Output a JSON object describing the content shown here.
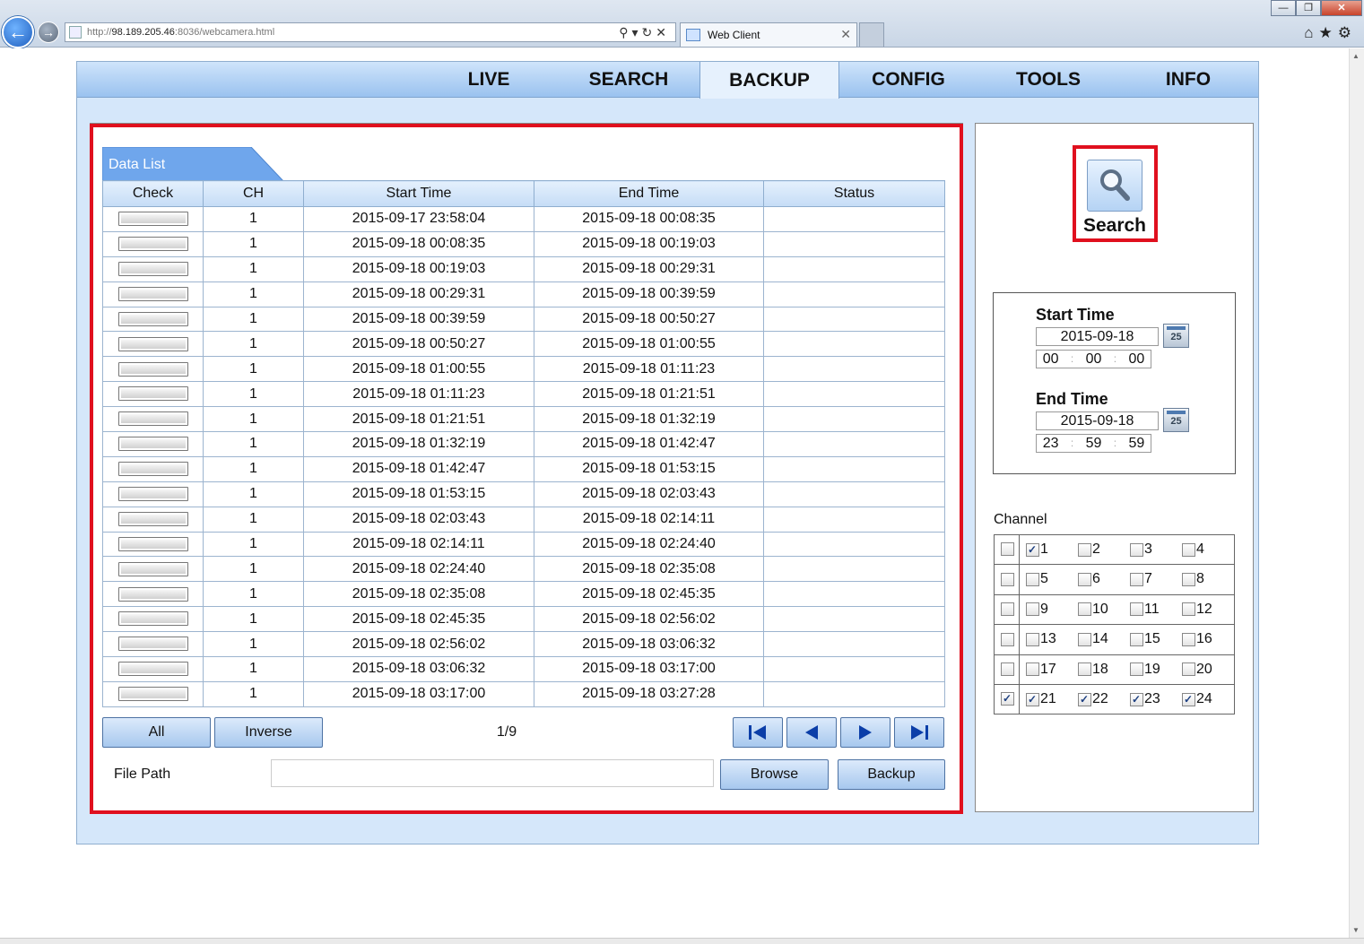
{
  "browser": {
    "url_prefix": "http://",
    "url_host": "98.189.205.46",
    "url_rest": ":8036/webcamera.html",
    "tab_title": "Web Client"
  },
  "menu": [
    "LIVE",
    "SEARCH",
    "BACKUP",
    "CONFIG",
    "TOOLS",
    "INFO"
  ],
  "active_menu": "BACKUP",
  "data_list": {
    "title": "Data List",
    "columns": [
      "Check",
      "CH",
      "Start Time",
      "End Time",
      "Status"
    ],
    "rows": [
      {
        "ch": "1",
        "start": "2015-09-17 23:58:04",
        "end": "2015-09-18 00:08:35",
        "status": ""
      },
      {
        "ch": "1",
        "start": "2015-09-18 00:08:35",
        "end": "2015-09-18 00:19:03",
        "status": ""
      },
      {
        "ch": "1",
        "start": "2015-09-18 00:19:03",
        "end": "2015-09-18 00:29:31",
        "status": ""
      },
      {
        "ch": "1",
        "start": "2015-09-18 00:29:31",
        "end": "2015-09-18 00:39:59",
        "status": ""
      },
      {
        "ch": "1",
        "start": "2015-09-18 00:39:59",
        "end": "2015-09-18 00:50:27",
        "status": ""
      },
      {
        "ch": "1",
        "start": "2015-09-18 00:50:27",
        "end": "2015-09-18 01:00:55",
        "status": ""
      },
      {
        "ch": "1",
        "start": "2015-09-18 01:00:55",
        "end": "2015-09-18 01:11:23",
        "status": ""
      },
      {
        "ch": "1",
        "start": "2015-09-18 01:11:23",
        "end": "2015-09-18 01:21:51",
        "status": ""
      },
      {
        "ch": "1",
        "start": "2015-09-18 01:21:51",
        "end": "2015-09-18 01:32:19",
        "status": ""
      },
      {
        "ch": "1",
        "start": "2015-09-18 01:32:19",
        "end": "2015-09-18 01:42:47",
        "status": ""
      },
      {
        "ch": "1",
        "start": "2015-09-18 01:42:47",
        "end": "2015-09-18 01:53:15",
        "status": ""
      },
      {
        "ch": "1",
        "start": "2015-09-18 01:53:15",
        "end": "2015-09-18 02:03:43",
        "status": ""
      },
      {
        "ch": "1",
        "start": "2015-09-18 02:03:43",
        "end": "2015-09-18 02:14:11",
        "status": ""
      },
      {
        "ch": "1",
        "start": "2015-09-18 02:14:11",
        "end": "2015-09-18 02:24:40",
        "status": ""
      },
      {
        "ch": "1",
        "start": "2015-09-18 02:24:40",
        "end": "2015-09-18 02:35:08",
        "status": ""
      },
      {
        "ch": "1",
        "start": "2015-09-18 02:35:08",
        "end": "2015-09-18 02:45:35",
        "status": ""
      },
      {
        "ch": "1",
        "start": "2015-09-18 02:45:35",
        "end": "2015-09-18 02:56:02",
        "status": ""
      },
      {
        "ch": "1",
        "start": "2015-09-18 02:56:02",
        "end": "2015-09-18 03:06:32",
        "status": ""
      },
      {
        "ch": "1",
        "start": "2015-09-18 03:06:32",
        "end": "2015-09-18 03:17:00",
        "status": ""
      },
      {
        "ch": "1",
        "start": "2015-09-18 03:17:00",
        "end": "2015-09-18 03:27:28",
        "status": ""
      }
    ]
  },
  "controls": {
    "all_label": "All",
    "inverse_label": "Inverse",
    "page_indicator": "1/9",
    "file_path_label": "File Path",
    "file_path_value": "",
    "browse_label": "Browse",
    "backup_label": "Backup"
  },
  "search_panel": {
    "search_label": "Search",
    "start_time_label": "Start Time",
    "start_date": "2015-09-18",
    "start_h": "00",
    "start_m": "00",
    "start_s": "00",
    "end_time_label": "End Time",
    "end_date": "2015-09-18",
    "end_h": "23",
    "end_m": "59",
    "end_s": "59",
    "calendar_label": "25",
    "channel_label": "Channel",
    "channels": [
      {
        "row_checked": false,
        "items": [
          {
            "n": "1",
            "on": true
          },
          {
            "n": "2",
            "on": false
          },
          {
            "n": "3",
            "on": false
          },
          {
            "n": "4",
            "on": false
          }
        ]
      },
      {
        "row_checked": false,
        "items": [
          {
            "n": "5",
            "on": false
          },
          {
            "n": "6",
            "on": false
          },
          {
            "n": "7",
            "on": false
          },
          {
            "n": "8",
            "on": false
          }
        ]
      },
      {
        "row_checked": false,
        "items": [
          {
            "n": "9",
            "on": false
          },
          {
            "n": "10",
            "on": false
          },
          {
            "n": "11",
            "on": false
          },
          {
            "n": "12",
            "on": false
          }
        ]
      },
      {
        "row_checked": false,
        "items": [
          {
            "n": "13",
            "on": false
          },
          {
            "n": "14",
            "on": false
          },
          {
            "n": "15",
            "on": false
          },
          {
            "n": "16",
            "on": false
          }
        ]
      },
      {
        "row_checked": false,
        "items": [
          {
            "n": "17",
            "on": false
          },
          {
            "n": "18",
            "on": false
          },
          {
            "n": "19",
            "on": false
          },
          {
            "n": "20",
            "on": false
          }
        ]
      },
      {
        "row_checked": true,
        "items": [
          {
            "n": "21",
            "on": true
          },
          {
            "n": "22",
            "on": true
          },
          {
            "n": "23",
            "on": true
          },
          {
            "n": "24",
            "on": true
          }
        ]
      }
    ]
  },
  "colors": {
    "highlight": "#e0101e",
    "menu_bg": "#9ac2ef",
    "panel_bg": "#d5e7fa"
  }
}
